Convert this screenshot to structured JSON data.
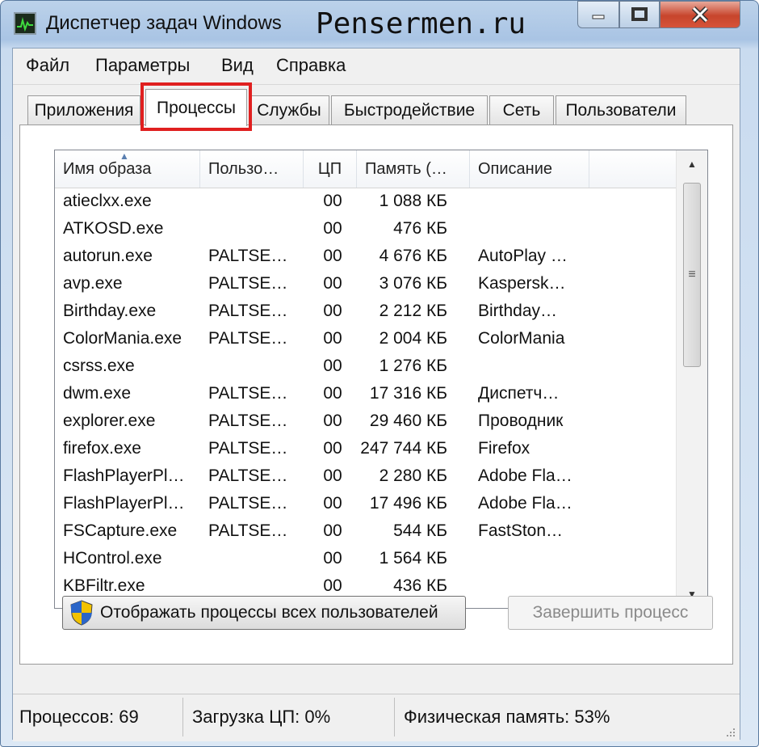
{
  "window": {
    "title": "Диспетчер задач Windows",
    "watermark": "Pensermen.ru"
  },
  "menu": [
    "Файл",
    "Параметры",
    "Вид",
    "Справка"
  ],
  "tabs": [
    "Приложения",
    "Процессы",
    "Службы",
    "Быстродействие",
    "Сеть",
    "Пользователи"
  ],
  "active_tab": "Процессы",
  "columns": [
    "Имя образа",
    "Пользо…",
    "ЦП",
    "Память (…",
    "Описание"
  ],
  "processes": [
    {
      "name": "atieclxx.exe",
      "user": "",
      "cpu": "00",
      "mem": "1 088 КБ",
      "desc": ""
    },
    {
      "name": "ATKOSD.exe",
      "user": "",
      "cpu": "00",
      "mem": "476 КБ",
      "desc": ""
    },
    {
      "name": "autorun.exe",
      "user": "PALTSE…",
      "cpu": "00",
      "mem": "4 676 КБ",
      "desc": "AutoPlay …"
    },
    {
      "name": "avp.exe",
      "user": "PALTSE…",
      "cpu": "00",
      "mem": "3 076 КБ",
      "desc": "Kaspersk…"
    },
    {
      "name": "Birthday.exe",
      "user": "PALTSE…",
      "cpu": "00",
      "mem": "2 212 КБ",
      "desc": "Birthday…"
    },
    {
      "name": "ColorMania.exe",
      "user": "PALTSE…",
      "cpu": "00",
      "mem": "2 004 КБ",
      "desc": "ColorMania"
    },
    {
      "name": "csrss.exe",
      "user": "",
      "cpu": "00",
      "mem": "1 276 КБ",
      "desc": ""
    },
    {
      "name": "dwm.exe",
      "user": "PALTSE…",
      "cpu": "00",
      "mem": "17 316 КБ",
      "desc": "Диспетч…"
    },
    {
      "name": "explorer.exe",
      "user": "PALTSE…",
      "cpu": "00",
      "mem": "29 460 КБ",
      "desc": "Проводник"
    },
    {
      "name": "firefox.exe",
      "user": "PALTSE…",
      "cpu": "00",
      "mem": "247 744 КБ",
      "desc": "Firefox"
    },
    {
      "name": "FlashPlayerPl…",
      "user": "PALTSE…",
      "cpu": "00",
      "mem": "2 280 КБ",
      "desc": "Adobe Fla…"
    },
    {
      "name": "FlashPlayerPl…",
      "user": "PALTSE…",
      "cpu": "00",
      "mem": "17 496 КБ",
      "desc": "Adobe Fla…"
    },
    {
      "name": "FSCapture.exe",
      "user": "PALTSE…",
      "cpu": "00",
      "mem": "544 КБ",
      "desc": "FastSton…"
    },
    {
      "name": "HControl.exe",
      "user": "",
      "cpu": "00",
      "mem": "1 564 КБ",
      "desc": ""
    },
    {
      "name": "KBFiltr.exe",
      "user": "",
      "cpu": "00",
      "mem": "436 КБ",
      "desc": ""
    }
  ],
  "buttons": {
    "show_all": "Отображать процессы всех пользователей",
    "end_process": "Завершить процесс"
  },
  "status": {
    "processes": "Процессов: 69",
    "cpu": "Загрузка ЦП: 0%",
    "memory": "Физическая память: 53%"
  },
  "colors": {
    "highlight": "#e02020",
    "close_button": "#c7452c"
  }
}
